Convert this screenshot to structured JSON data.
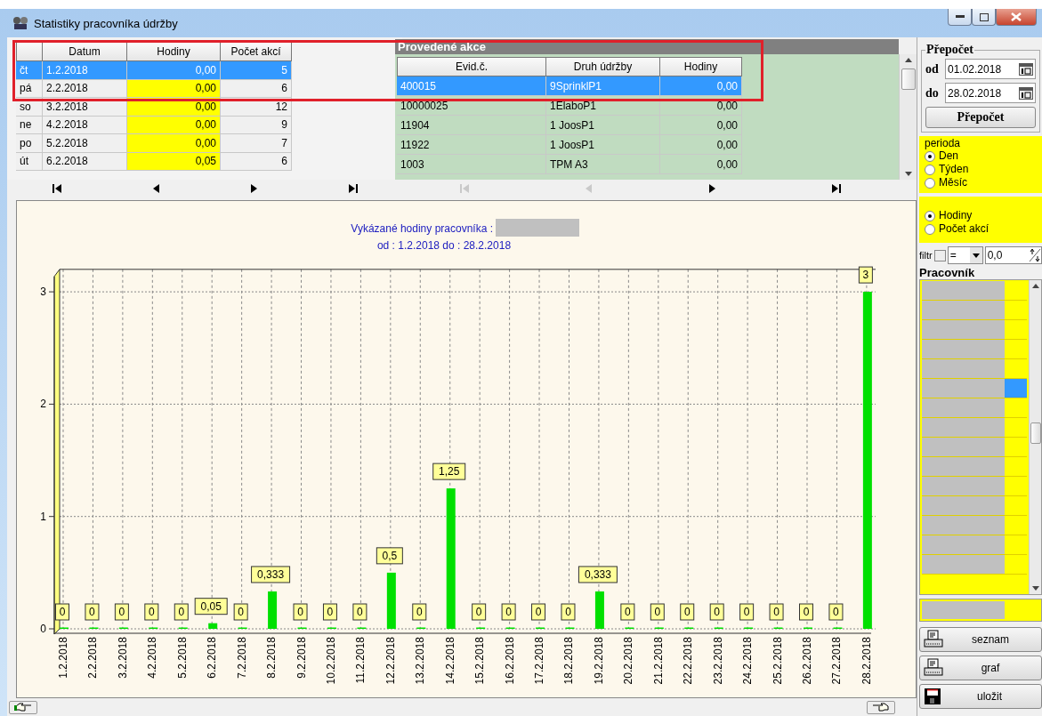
{
  "window": {
    "title": "Statistiky pracovníka údržby"
  },
  "days_table": {
    "columns": [
      "Datum",
      "Hodiny",
      "Počet akcí"
    ],
    "rows": [
      {
        "day": "čt",
        "date": "1.2.2018",
        "hours": "0,00",
        "count": "5",
        "selected": true
      },
      {
        "day": "pá",
        "date": "2.2.2018",
        "hours": "0,00",
        "count": "6",
        "selected": false
      },
      {
        "day": "so",
        "date": "3.2.2018",
        "hours": "0,00",
        "count": "12",
        "selected": false
      },
      {
        "day": "ne",
        "date": "4.2.2018",
        "hours": "0,00",
        "count": "9",
        "selected": false
      },
      {
        "day": "po",
        "date": "5.2.2018",
        "hours": "0,00",
        "count": "7",
        "selected": false
      },
      {
        "day": "út",
        "date": "6.2.2018",
        "hours": "0,05",
        "count": "6",
        "selected": false
      }
    ],
    "nav": [
      {
        "kind": "first",
        "disabled": false
      },
      {
        "kind": "prev",
        "disabled": false
      },
      {
        "kind": "next",
        "disabled": false
      },
      {
        "kind": "last",
        "disabled": false
      }
    ]
  },
  "actions": {
    "title": "Provedené akce",
    "columns": [
      "Evid.č.",
      "Druh údržby",
      "Hodiny"
    ],
    "rows": [
      {
        "id": "400015",
        "type": "9SprinklP1",
        "hours": "0,00",
        "selected": true
      },
      {
        "id": "10000025",
        "type": "1ElaboP1",
        "hours": "0,00",
        "selected": false
      },
      {
        "id": "11904",
        "type": "1 JoosP1",
        "hours": "0,00",
        "selected": false
      },
      {
        "id": "11922",
        "type": "1 JoosP1",
        "hours": "0,00",
        "selected": false
      },
      {
        "id": "1003",
        "type": "TPM A3",
        "hours": "0,00",
        "selected": false
      }
    ],
    "nav": [
      {
        "kind": "first",
        "disabled": true
      },
      {
        "kind": "prev",
        "disabled": true
      },
      {
        "kind": "next",
        "disabled": false
      },
      {
        "kind": "last",
        "disabled": false
      }
    ]
  },
  "chart": {
    "title": "Vykázané hodiny pracovníka :",
    "subtitle": "od : 1.2.2018 do : 28.2.2018",
    "chart_data": {
      "type": "bar",
      "categories": [
        "1.2.2018",
        "2.2.2018",
        "3.2.2018",
        "4.2.2018",
        "5.2.2018",
        "6.2.2018",
        "7.2.2018",
        "8.2.2018",
        "9.2.2018",
        "10.2.2018",
        "11.2.2018",
        "12.2.2018",
        "13.2.2018",
        "14.2.2018",
        "15.2.2018",
        "16.2.2018",
        "17.2.2018",
        "18.2.2018",
        "19.2.2018",
        "20.2.2018",
        "21.2.2018",
        "22.2.2018",
        "23.2.2018",
        "24.2.2018",
        "25.2.2018",
        "26.2.2018",
        "27.2.2018",
        "28.2.2018"
      ],
      "grid": true,
      "series": [
        {
          "color": "#00e000",
          "values": [
            0,
            0,
            0,
            0,
            0,
            0.05,
            0,
            0.333,
            0,
            0,
            0,
            0.5,
            0,
            1.25,
            0,
            0,
            0,
            0,
            0.333,
            0,
            0,
            0,
            0,
            0,
            0,
            0,
            0,
            3
          ]
        }
      ],
      "value_labels": [
        "0",
        "0",
        "0",
        "0",
        "0",
        "0,05",
        "0",
        "0,333",
        "0",
        "0",
        "0",
        "0,5",
        "0",
        "1,25",
        "0",
        "0",
        "0",
        "0",
        "0,333",
        "0",
        "0",
        "0",
        "0",
        "0",
        "0",
        "0",
        "0",
        "3"
      ],
      "ylim": [
        0,
        3.2
      ],
      "yticks": [
        0,
        1,
        2,
        3
      ]
    }
  },
  "recalc": {
    "title": "Přepočet",
    "from_label": "od",
    "from": "01.02.2018",
    "to_label": "do",
    "to": "28.02.2018",
    "button": "Přepočet"
  },
  "period": {
    "title": "perioda",
    "options": [
      {
        "label": "Den",
        "selected": true
      },
      {
        "label": "Týden",
        "selected": false
      },
      {
        "label": "Měsíc",
        "selected": false
      }
    ]
  },
  "measure": {
    "options": [
      {
        "label": "Hodiny",
        "selected": true
      },
      {
        "label": "Počet akcí",
        "selected": false
      }
    ]
  },
  "filter": {
    "label": "filtr",
    "checked": false,
    "operator": "=",
    "value": "0,0"
  },
  "workers": {
    "title": "Pracovník",
    "rows": [
      {
        "selected": false
      },
      {
        "selected": false
      },
      {
        "selected": false
      },
      {
        "selected": false
      },
      {
        "selected": false
      },
      {
        "selected": true
      },
      {
        "selected": false
      },
      {
        "selected": false
      },
      {
        "selected": false
      },
      {
        "selected": false
      },
      {
        "selected": false
      },
      {
        "selected": false
      },
      {
        "selected": false
      },
      {
        "selected": false
      },
      {
        "selected": false
      }
    ]
  },
  "buttons": [
    {
      "label": "seznam",
      "kind": "print"
    },
    {
      "label": "graf",
      "kind": "print"
    },
    {
      "label": "uložit",
      "kind": "save"
    }
  ]
}
